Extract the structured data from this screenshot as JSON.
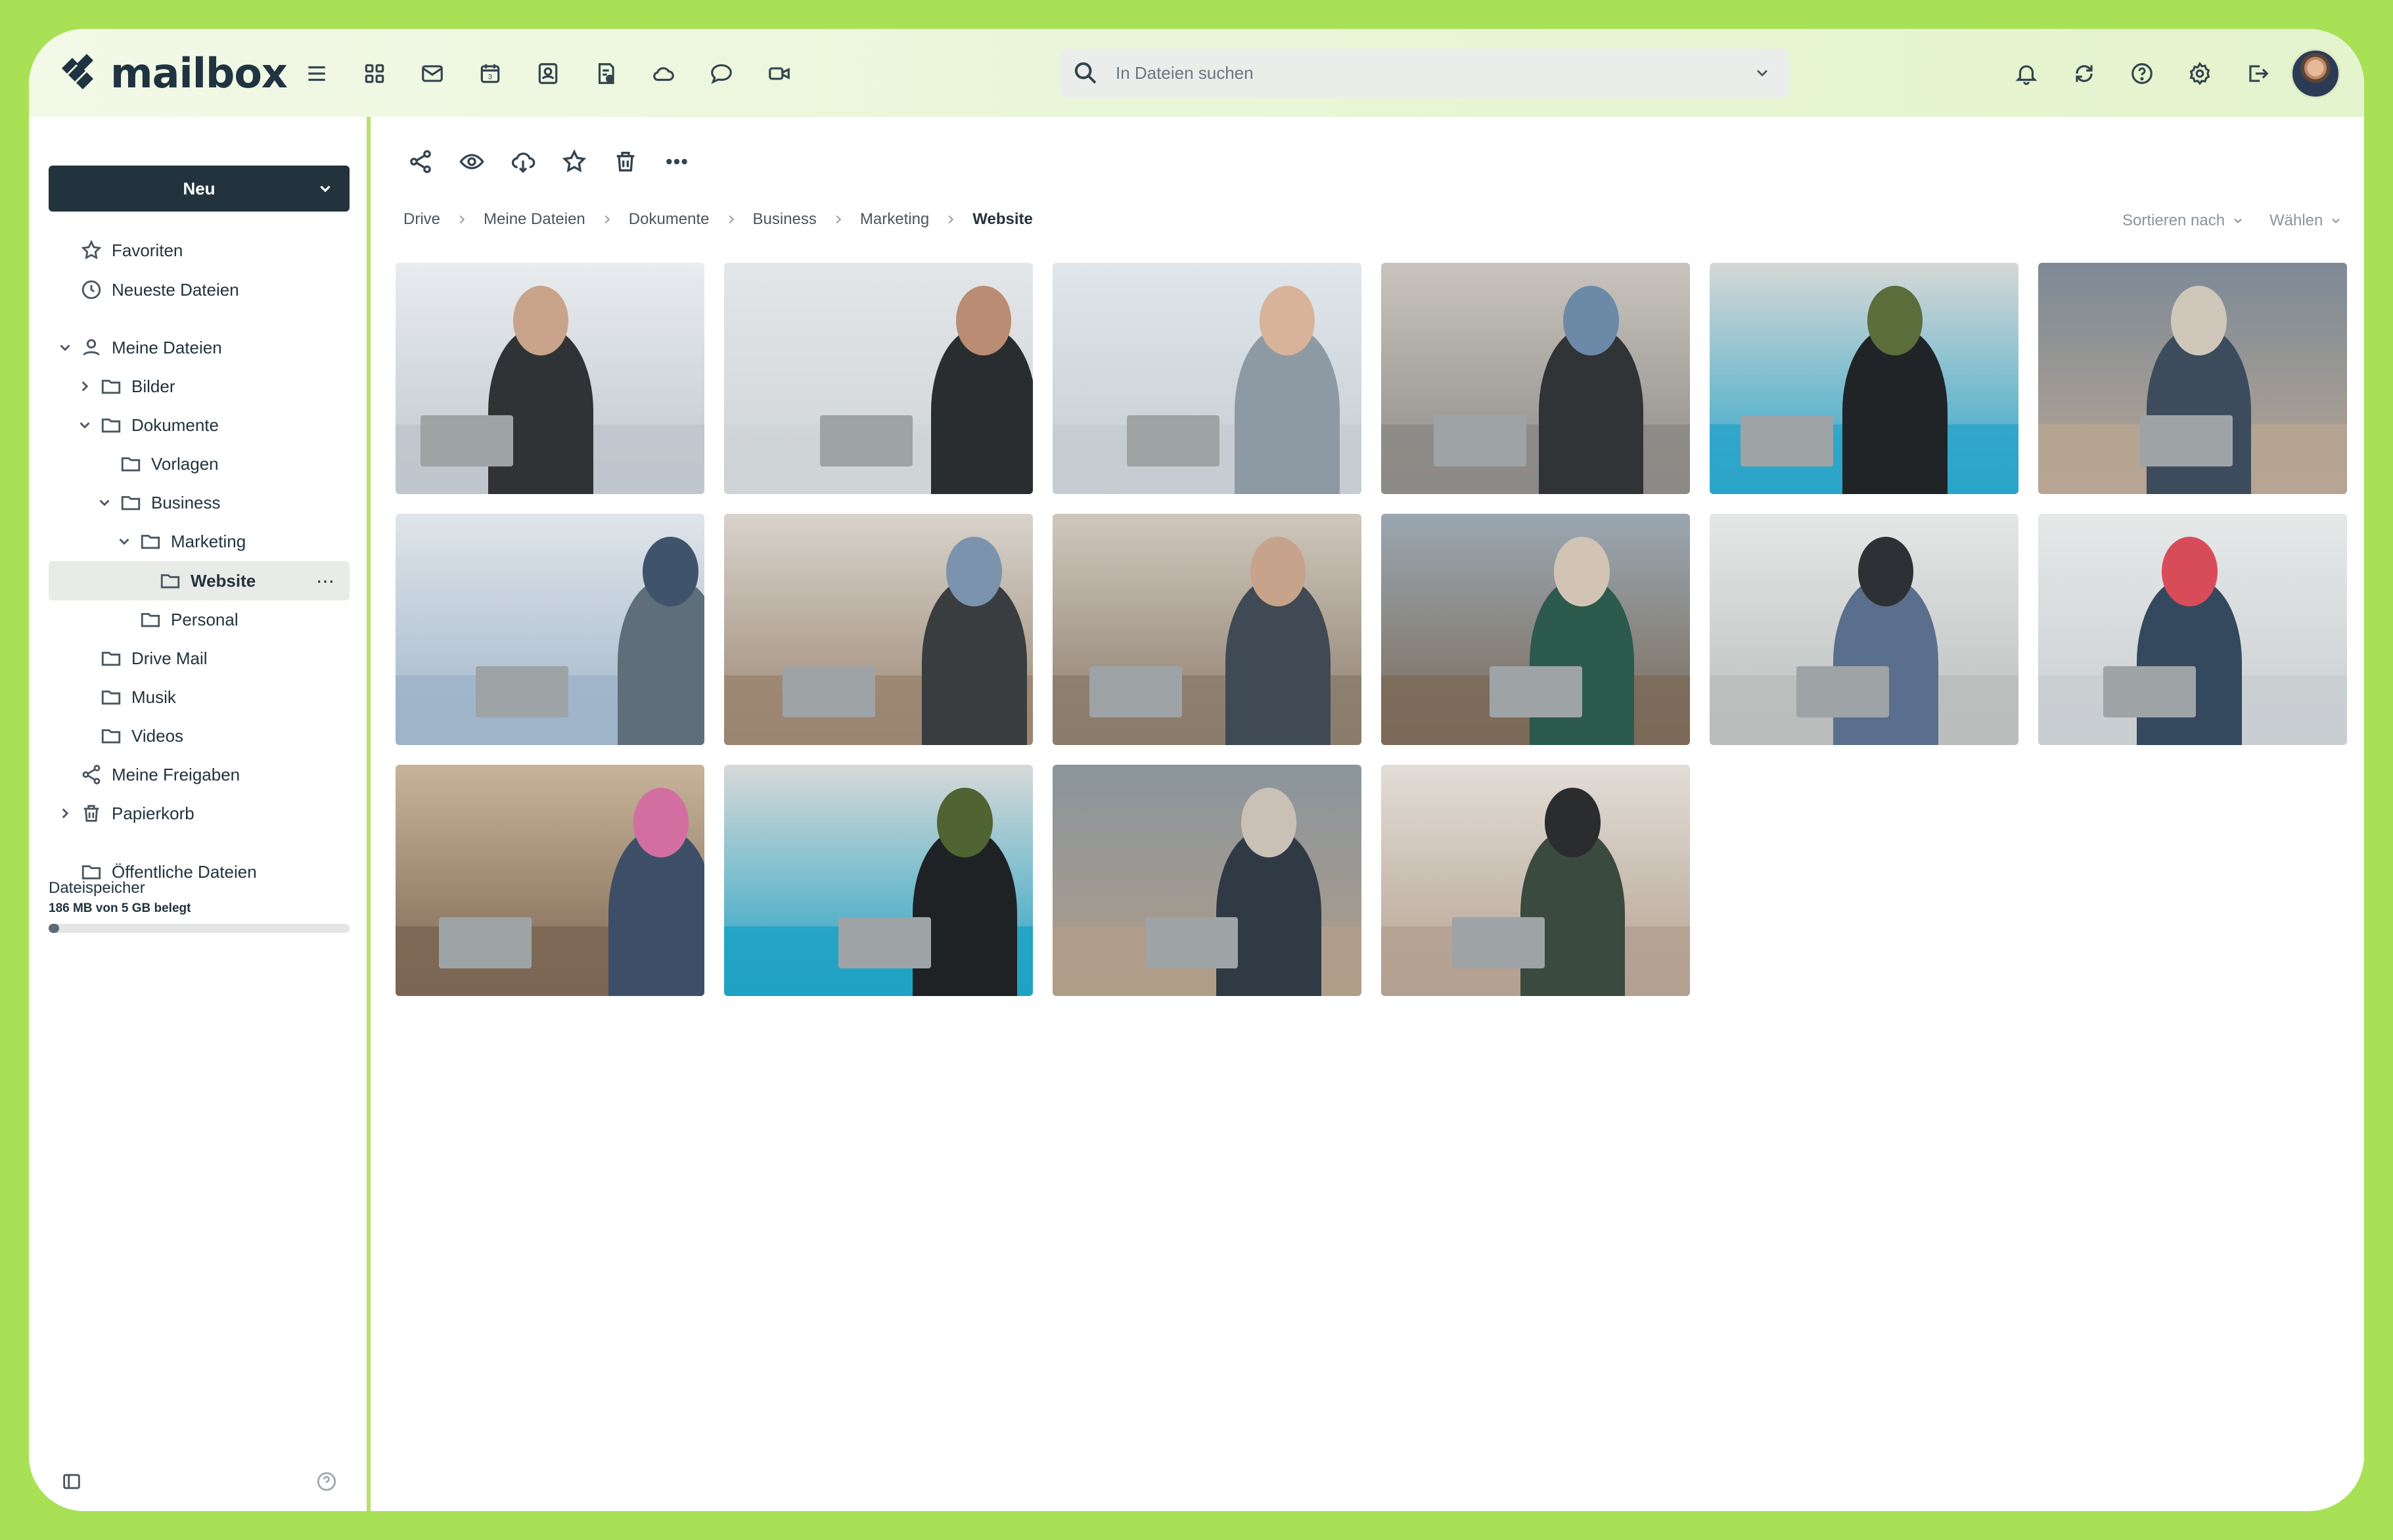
{
  "app": {
    "logo_text": "mailbox"
  },
  "header": {
    "search_placeholder": "In Dateien suchen",
    "calendar_day": "3",
    "nav_icons": [
      "menu-icon",
      "apps-grid-icon",
      "mail-icon",
      "calendar-icon",
      "contacts-icon",
      "tasks-icon",
      "cloud-icon",
      "chat-icon",
      "video-icon"
    ],
    "right_icons": [
      "bell-icon",
      "sync-icon",
      "help-icon",
      "gear-icon",
      "logout-icon"
    ]
  },
  "sidebar": {
    "new_button": "Neu",
    "items": [
      {
        "label": "Favoriten",
        "icon": "star-icon"
      },
      {
        "label": "Neueste Dateien",
        "icon": "clock-icon"
      },
      {
        "label": "Meine Dateien",
        "icon": "user-icon"
      },
      {
        "label": "Bilder",
        "icon": "folder-icon"
      },
      {
        "label": "Dokumente",
        "icon": "folder-icon"
      },
      {
        "label": "Vorlagen",
        "icon": "folder-icon"
      },
      {
        "label": "Business",
        "icon": "folder-icon"
      },
      {
        "label": "Marketing",
        "icon": "folder-icon"
      },
      {
        "label": "Website",
        "icon": "folder-icon",
        "active": true
      },
      {
        "label": "Personal",
        "icon": "folder-icon"
      },
      {
        "label": "Drive Mail",
        "icon": "folder-icon"
      },
      {
        "label": "Musik",
        "icon": "folder-icon"
      },
      {
        "label": "Videos",
        "icon": "folder-icon"
      },
      {
        "label": "Meine Freigaben",
        "icon": "share-icon"
      },
      {
        "label": "Papierkorb",
        "icon": "trash-icon"
      },
      {
        "label": "Öffentliche Dateien",
        "icon": "folder-icon"
      }
    ],
    "active_more": "⋯",
    "storage": {
      "label": "Dateispeicher",
      "value": "186 MB von 5 GB belegt",
      "used_fraction": 0.036
    }
  },
  "toolbar": {
    "icons": [
      "share-icon",
      "preview-eye-icon",
      "download-cloud-icon",
      "star-icon",
      "trash-icon",
      "more-icon"
    ]
  },
  "breadcrumb": [
    "Drive",
    "Meine Dateien",
    "Dokumente",
    "Business",
    "Marketing",
    "Website"
  ],
  "sort": {
    "sort_label": "Sortieren nach",
    "select_label": "Wählen"
  },
  "photos": [
    {
      "name": "photo-1"
    },
    {
      "name": "photo-2"
    },
    {
      "name": "photo-3"
    },
    {
      "name": "photo-4"
    },
    {
      "name": "photo-5"
    },
    {
      "name": "photo-6"
    },
    {
      "name": "photo-7"
    },
    {
      "name": "photo-8"
    },
    {
      "name": "photo-9"
    },
    {
      "name": "photo-10"
    },
    {
      "name": "photo-11"
    },
    {
      "name": "photo-12"
    },
    {
      "name": "photo-13"
    },
    {
      "name": "photo-14"
    },
    {
      "name": "photo-15"
    },
    {
      "name": "photo-16"
    }
  ],
  "colors": {
    "accent": "#a8e156",
    "primary_dark": "#22333d",
    "header_bg": "#eaf6d9"
  }
}
